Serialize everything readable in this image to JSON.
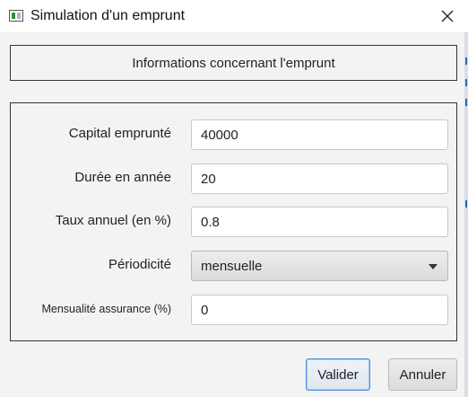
{
  "window": {
    "title": "Simulation d'un emprunt",
    "app_icon": "window-app-icon",
    "close_icon": "close-icon"
  },
  "header": {
    "text": "Informations concernant l'emprunt"
  },
  "form": {
    "capital": {
      "label": "Capital emprunté",
      "value": "40000"
    },
    "duree": {
      "label": "Durée en année",
      "value": "20"
    },
    "taux": {
      "label": "Taux annuel (en %)",
      "value": "0.8"
    },
    "periodicite": {
      "label": "Périodicité",
      "value": "mensuelle"
    },
    "assurance": {
      "label": "Mensualité assurance (%)",
      "value": "0"
    }
  },
  "buttons": {
    "ok": "Valider",
    "cancel": "Annuler"
  },
  "colors": {
    "focus_border": "#4a90d9",
    "panel_bg": "#f3f3f3"
  }
}
